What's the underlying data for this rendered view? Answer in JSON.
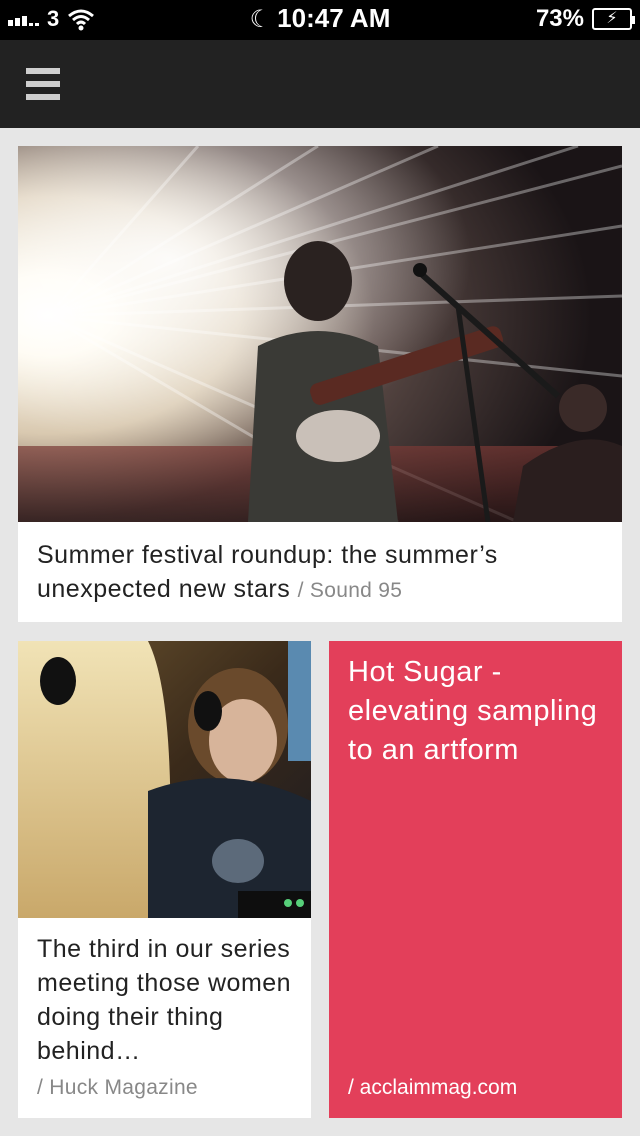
{
  "status_bar": {
    "carrier": "3",
    "time": "10:47 AM",
    "battery": "73%",
    "icons": [
      "signal-icon",
      "wifi-icon",
      "moon-icon",
      "battery-charging-icon"
    ]
  },
  "nav": {
    "menu_icon": "hamburger-menu-icon"
  },
  "featured": {
    "title": "Summer festival roundup: the summer’s unexpected new stars",
    "source": "/ Sound 95"
  },
  "left_card": {
    "title": "The third in our series meeting those women doing their thing behind…",
    "source": "/ Huck Magazine"
  },
  "right_card": {
    "title": "Hot Sugar - elevating sampling to an artform",
    "source": "/ acclaimmag.com",
    "color": "#e33f5a"
  }
}
